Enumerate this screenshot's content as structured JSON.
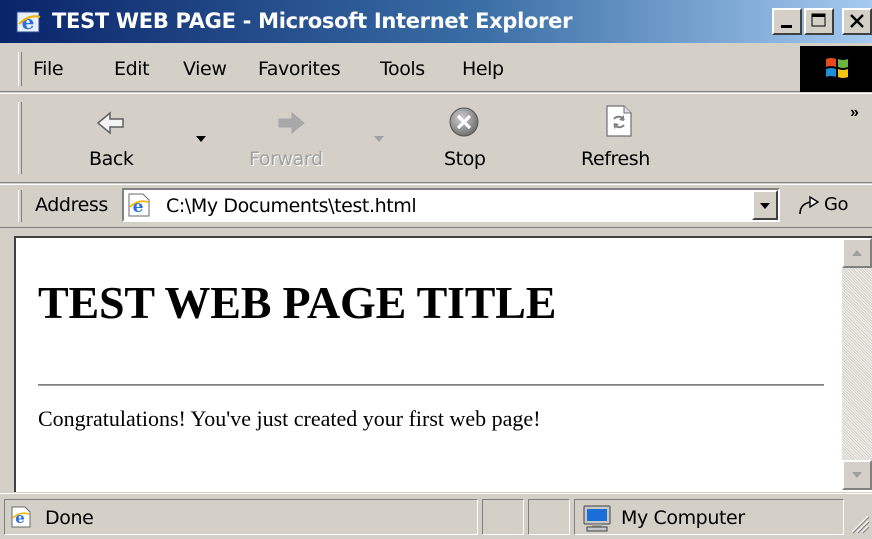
{
  "window": {
    "title": "TEST WEB PAGE - Microsoft Internet Explorer",
    "controls": {
      "minimize": "_",
      "maximize": "□",
      "close": "×"
    }
  },
  "menu": {
    "items": [
      {
        "label": "File"
      },
      {
        "label": "Edit"
      },
      {
        "label": "View"
      },
      {
        "label": "Favorites"
      },
      {
        "label": "Tools"
      },
      {
        "label": "Help"
      }
    ]
  },
  "toolbar": {
    "back_label": "Back",
    "forward_label": "Forward",
    "stop_label": "Stop",
    "refresh_label": "Refresh",
    "more_chevrons": "»",
    "forward_enabled": false
  },
  "address": {
    "label": "Address",
    "value": "C:\\My Documents\\test.html",
    "go_label": "Go"
  },
  "document": {
    "title": "TEST WEB PAGE TITLE",
    "paragraph": "Congratulations! You've just created your first web page!"
  },
  "status": {
    "text": "Done",
    "zone": "My Computer"
  },
  "colors": {
    "titlebar_start": "#0a246a",
    "titlebar_end": "#a6caf0",
    "chrome": "#d4d0c8",
    "page_background": "#ffffff"
  },
  "icons": {
    "title": "ie-logo-icon",
    "back": "back-arrow-icon",
    "forward": "forward-arrow-icon",
    "stop": "stop-icon",
    "refresh": "refresh-icon",
    "address_page": "ie-page-icon",
    "go": "go-arrow-icon",
    "status_page": "ie-page-icon",
    "zone": "my-computer-icon",
    "throbber": "windows-logo-icon"
  }
}
